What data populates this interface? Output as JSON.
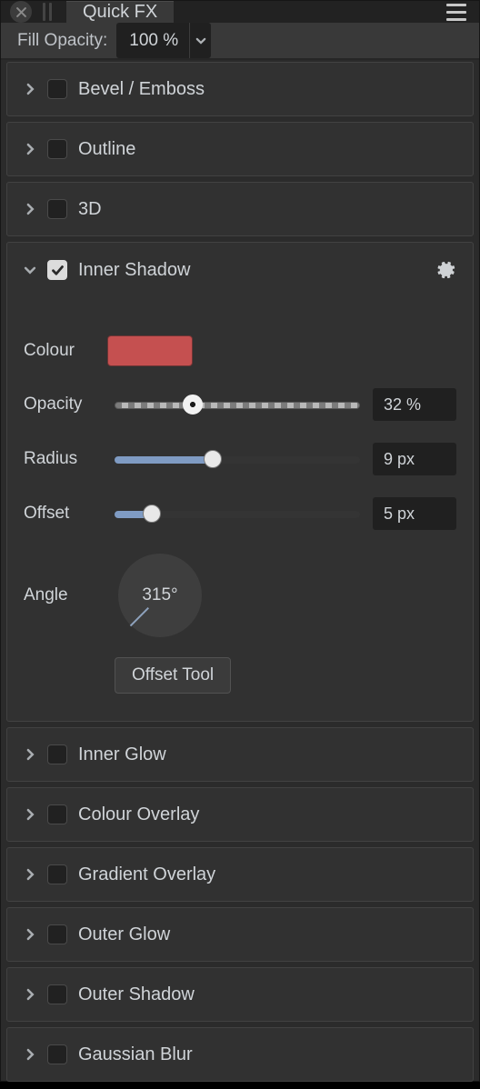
{
  "header": {
    "tab_title": "Quick FX"
  },
  "fill": {
    "label": "Fill Opacity:",
    "value": "100 %"
  },
  "effects": {
    "collapsed_top": [
      {
        "label": "Bevel / Emboss",
        "checked": false
      },
      {
        "label": "Outline",
        "checked": false
      },
      {
        "label": "3D",
        "checked": false
      }
    ],
    "inner_shadow": {
      "label": "Inner Shadow",
      "checked": true,
      "colour_label": "Colour",
      "colour_hex": "#c55050",
      "opacity": {
        "label": "Opacity",
        "value_text": "32 %",
        "percent": 32
      },
      "radius": {
        "label": "Radius",
        "value_text": "9 px",
        "percent": 40
      },
      "offset": {
        "label": "Offset",
        "value_text": "5 px",
        "percent": 15
      },
      "angle": {
        "label": "Angle",
        "value_text": "315°",
        "degrees": 315
      },
      "offset_tool_label": "Offset Tool"
    },
    "collapsed_bottom": [
      {
        "label": "Inner Glow",
        "checked": false
      },
      {
        "label": "Colour Overlay",
        "checked": false
      },
      {
        "label": "Gradient Overlay",
        "checked": false
      },
      {
        "label": "Outer Glow",
        "checked": false
      },
      {
        "label": "Outer Shadow",
        "checked": false
      },
      {
        "label": "Gaussian Blur",
        "checked": false
      }
    ]
  }
}
